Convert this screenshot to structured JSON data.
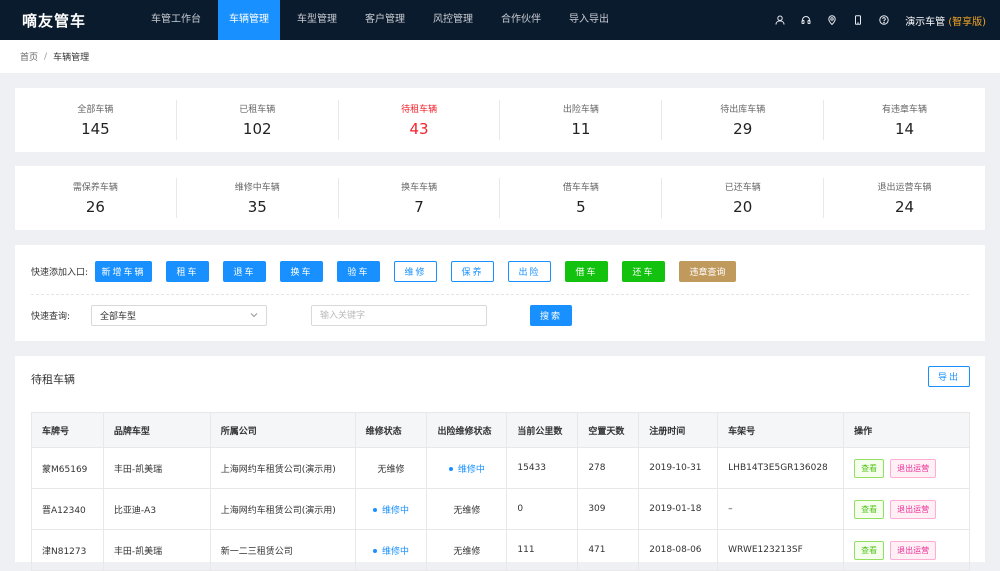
{
  "app": {
    "logo": "嘀友管车"
  },
  "nav": {
    "items": [
      "车管工作台",
      "车辆管理",
      "车型管理",
      "客户管理",
      "风控管理",
      "合作伙伴",
      "导入导出"
    ],
    "active_index": 1
  },
  "topbar": {
    "icons": [
      "user-icon",
      "headset-icon",
      "location-pin-icon",
      "phone-icon",
      "help-icon"
    ],
    "user_name": "演示车管",
    "version_label": "(智享版)"
  },
  "breadcrumb": {
    "home": "首页",
    "separator": "/",
    "current": "车辆管理"
  },
  "stats_row1": [
    {
      "label": "全部车辆",
      "value": "145"
    },
    {
      "label": "已租车辆",
      "value": "102"
    },
    {
      "label": "待租车辆",
      "value": "43",
      "highlight": true
    },
    {
      "label": "出险车辆",
      "value": "11"
    },
    {
      "label": "待出库车辆",
      "value": "29"
    },
    {
      "label": "有违章车辆",
      "value": "14"
    }
  ],
  "stats_row2": [
    {
      "label": "需保养车辆",
      "value": "26"
    },
    {
      "label": "维修中车辆",
      "value": "35"
    },
    {
      "label": "换车车辆",
      "value": "7"
    },
    {
      "label": "借车车辆",
      "value": "5"
    },
    {
      "label": "已还车辆",
      "value": "20"
    },
    {
      "label": "退出运营车辆",
      "value": "24"
    }
  ],
  "quick_add": {
    "label": "快速添加入口:",
    "buttons": [
      {
        "label": "新增车辆",
        "style": "primary"
      },
      {
        "label": "租车",
        "style": "primary"
      },
      {
        "label": "退车",
        "style": "primary"
      },
      {
        "label": "换车",
        "style": "primary"
      },
      {
        "label": "验车",
        "style": "primary"
      },
      {
        "label": "维修",
        "style": "outline"
      },
      {
        "label": "保养",
        "style": "outline"
      },
      {
        "label": "出险",
        "style": "outline"
      },
      {
        "label": "借车",
        "style": "green"
      },
      {
        "label": "还车",
        "style": "green"
      },
      {
        "label": "违章查询",
        "style": "brown"
      }
    ]
  },
  "quick_search": {
    "label": "快速查询:",
    "select_value": "全部车型",
    "keyword_placeholder": "输入关键字",
    "keyword_value": "",
    "search_label": "搜索"
  },
  "panel": {
    "title": "待租车辆",
    "export_label": "导出"
  },
  "table": {
    "headers": [
      "车牌号",
      "品牌车型",
      "所属公司",
      "维修状态",
      "出险维修状态",
      "当前公里数",
      "空置天数",
      "注册时间",
      "车架号",
      "操作"
    ],
    "rows": [
      {
        "plate": "蒙M65169",
        "model": "丰田-凯美瑞",
        "company": "上海网约车租赁公司(演示用)",
        "repair": "无维修",
        "repair_active": false,
        "insurance_repair": "维修中",
        "insurance_active": true,
        "mileage": "15433",
        "idle_days": "278",
        "reg_date": "2019-10-31",
        "vin": "LHB14T3E5GR136028"
      },
      {
        "plate": "晋A12340",
        "model": "比亚迪-A3",
        "company": "上海网约车租赁公司(演示用)",
        "repair": "维修中",
        "repair_active": true,
        "insurance_repair": "无维修",
        "insurance_active": false,
        "mileage": "0",
        "idle_days": "309",
        "reg_date": "2019-01-18",
        "vin": "–"
      },
      {
        "plate": "津N81273",
        "model": "丰田-凯美瑞",
        "company": "新一二三租赁公司",
        "repair": "维修中",
        "repair_active": true,
        "insurance_repair": "无维修",
        "insurance_active": false,
        "mileage": "111",
        "idle_days": "471",
        "reg_date": "2018-08-06",
        "vin": "WRWE123213SF"
      }
    ],
    "view_label": "查看",
    "exit_label": "退出运营"
  }
}
